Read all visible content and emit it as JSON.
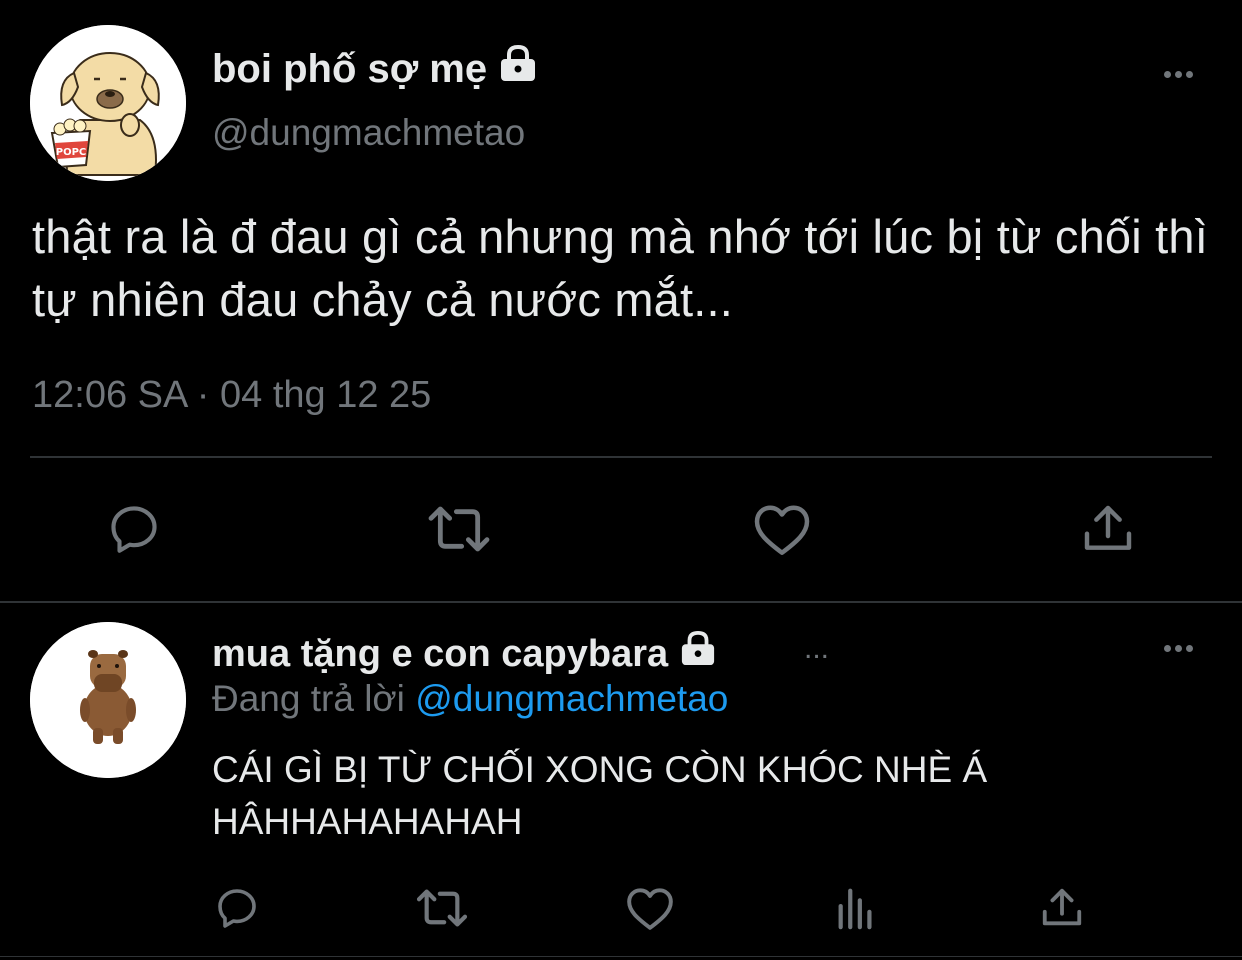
{
  "tweet": {
    "author_name": "boi phố sợ mẹ",
    "author_handle": "@dungmachmetao",
    "text": "thật ra là đ đau gì cả nhưng mà nhớ tới lúc bị từ chối thì tự nhiên đau chảy cả nước mắt...",
    "timestamp": "12:06 SA · 04 thg 12 25",
    "avatar_caption": "POPC",
    "avatar_icon": "dog-popcorn-avatar"
  },
  "reply": {
    "author_name": "mua tặng e con capybara",
    "replying_prefix": "Đang trả lời",
    "replying_to": "@dungmachmetao",
    "name_overflow": "...",
    "text": "CÁI GÌ BỊ TỪ CHỐI XONG CÒN KHÓC NHÈ Á HÂHHAHAHAHAH",
    "avatar_icon": "capybara-avatar"
  },
  "actions": {
    "main": [
      "reply-icon",
      "retweet-icon",
      "like-icon",
      "share-icon"
    ],
    "reply": [
      "reply-icon",
      "retweet-icon",
      "like-icon",
      "analytics-icon",
      "share-icon"
    ]
  },
  "colors": {
    "background": "#000000",
    "text": "#e7e9ea",
    "muted": "#71767b",
    "link": "#1d9bf0",
    "divider": "#2f3336"
  }
}
